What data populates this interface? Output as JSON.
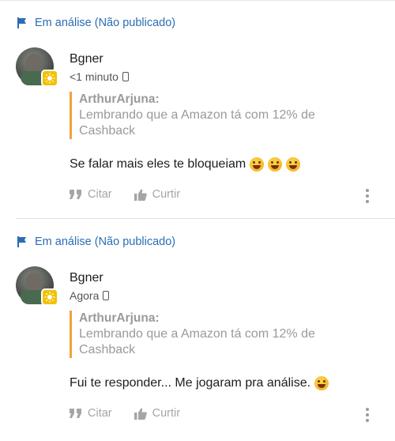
{
  "posts": [
    {
      "status": "Em análise (Não publicado)",
      "username": "Bgner",
      "time": "<1 minuto",
      "quote_author": "ArthurArjuna:",
      "quote_line1": "Lembrando que a Amazon tá com 12% de",
      "quote_line2": "Cashback",
      "message": "Se falar mais eles te bloqueiam",
      "emoji_count": 3,
      "cite_label": "Citar",
      "like_label": "Curtir"
    },
    {
      "status": "Em análise (Não publicado)",
      "username": "Bgner",
      "time": "Agora",
      "quote_author": "ArthurArjuna:",
      "quote_line1": "Lembrando que a Amazon tá com 12% de",
      "quote_line2": "Cashback",
      "message": "Fui te responder... Me jogaram pra análise.",
      "emoji_count": 1,
      "cite_label": "Citar",
      "like_label": "Curtir"
    }
  ],
  "colors": {
    "status_blue": "#2a6db5",
    "quote_bar": "#f0a23b",
    "badge": "#f2c200",
    "muted": "#9a9a9a"
  },
  "icons": [
    "flag-icon",
    "phone-icon",
    "quote-icon",
    "thumbs-up-icon",
    "more-options-icon",
    "grinning-emoji-icon",
    "award-badge-icon"
  ]
}
